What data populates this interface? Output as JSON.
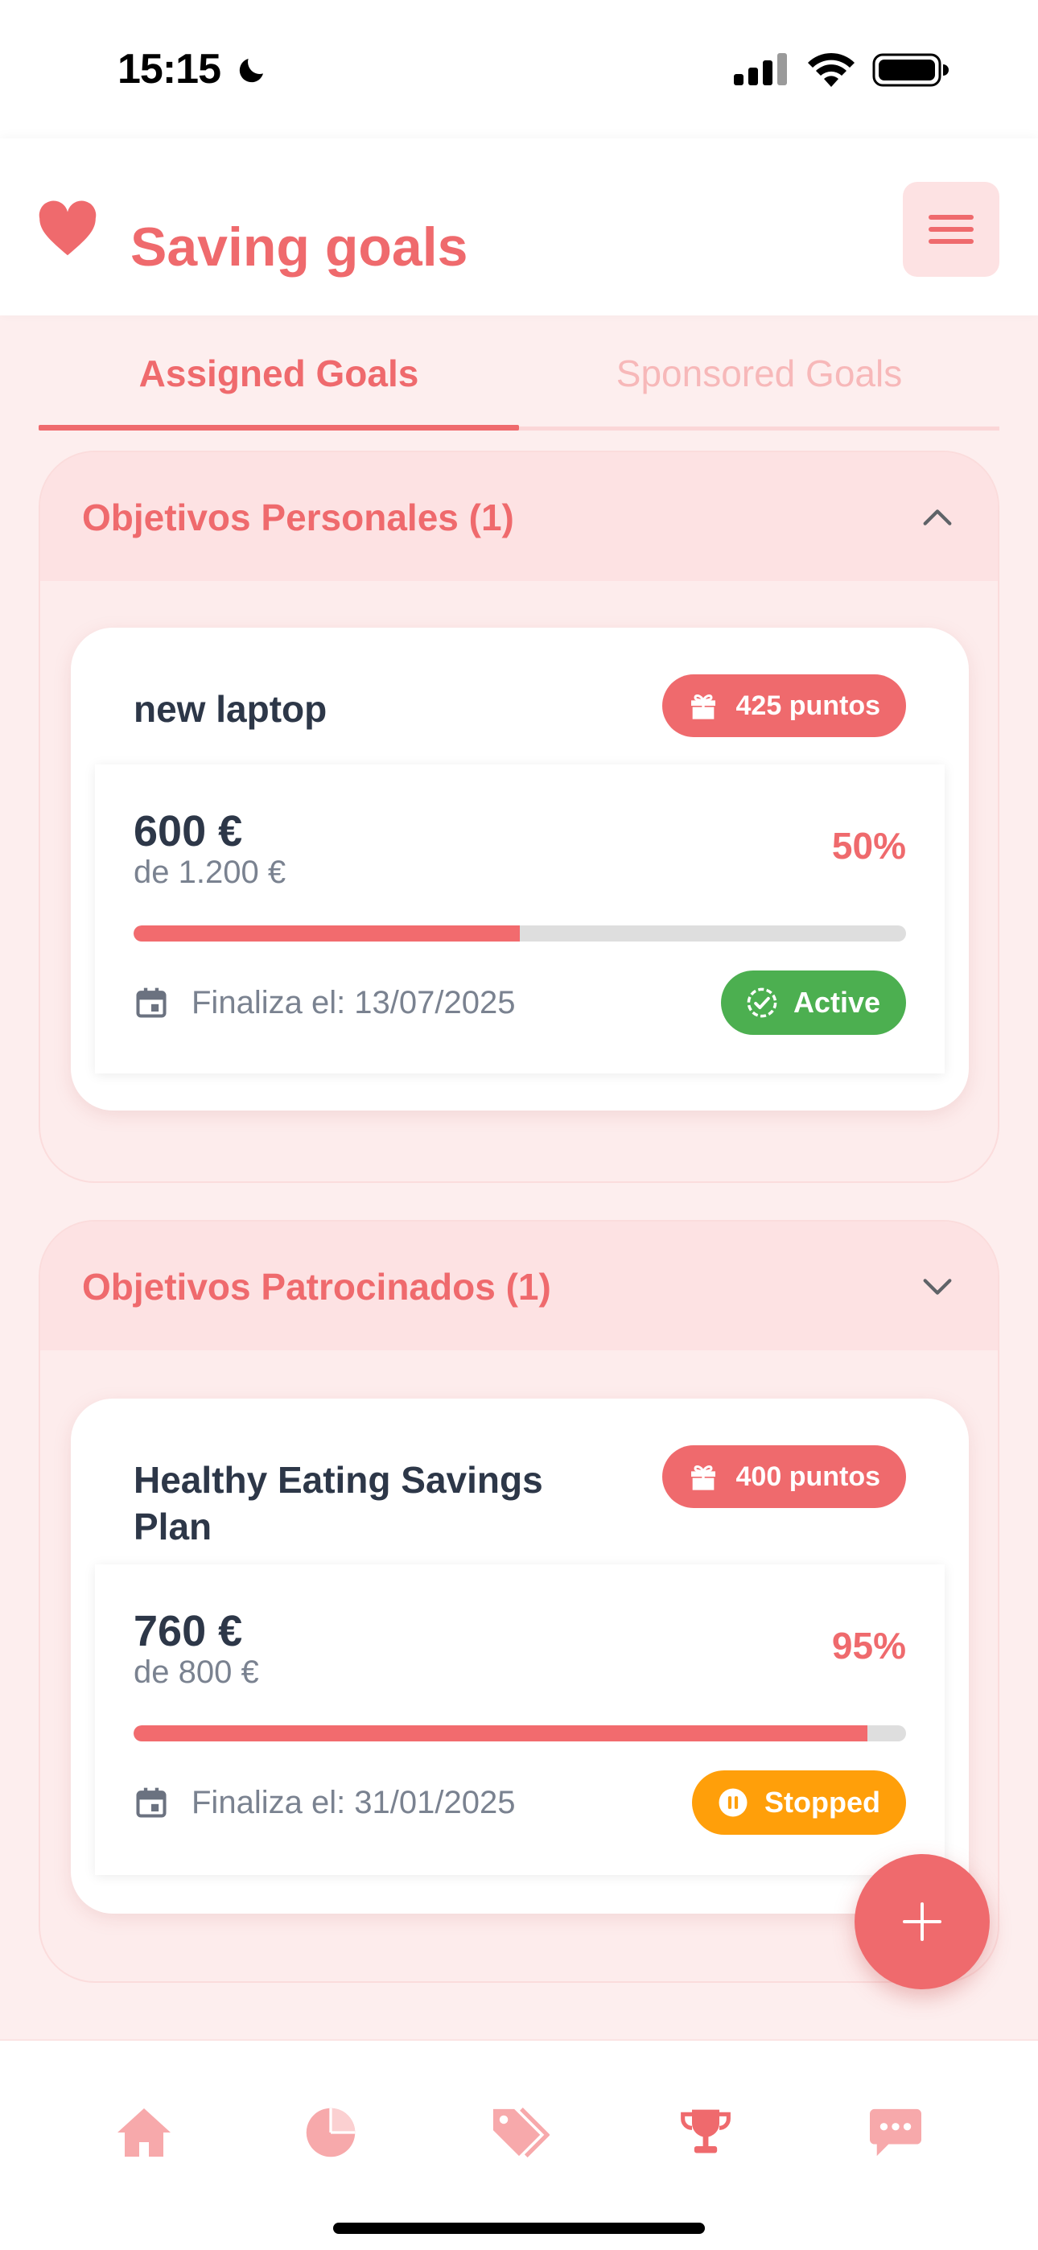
{
  "status_bar": {
    "time": "15:15"
  },
  "header": {
    "title": "Saving goals"
  },
  "tabs": [
    {
      "label": "Assigned Goals",
      "active": true
    },
    {
      "label": "Sponsored Goals",
      "active": false
    }
  ],
  "sections": [
    {
      "title": "Objetivos Personales (1)",
      "expanded": true,
      "goal": {
        "name": "new laptop",
        "points": "425 puntos",
        "amount": "600 €",
        "target": "de 1.200 €",
        "percent": "50%",
        "progress_fraction": 0.5,
        "end_date": "Finaliza el: 13/07/2025",
        "status": "Active"
      }
    },
    {
      "title": "Objetivos Patrocinados (1)",
      "expanded": false,
      "goal": {
        "name": "Healthy Eating Savings Plan",
        "points": "400 puntos",
        "amount": "760 €",
        "target": "de 800 €",
        "percent": "95%",
        "progress_fraction": 0.95,
        "end_date": "Finaliza el: 31/01/2025",
        "status": "Stopped"
      }
    }
  ],
  "bottom_nav": [
    {
      "icon": "home-icon",
      "active": false
    },
    {
      "icon": "pie-chart-icon",
      "active": false
    },
    {
      "icon": "tags-icon",
      "active": false
    },
    {
      "icon": "trophy-icon",
      "active": true
    },
    {
      "icon": "chat-icon",
      "active": false
    }
  ],
  "colors": {
    "accent": "#ef6a6d",
    "accent_light": "#fde2e3",
    "background": "#fdeeee",
    "active_status": "#4caf50",
    "stopped_status": "#ff9f0a",
    "nav_inactive": "#f7a9ab"
  }
}
